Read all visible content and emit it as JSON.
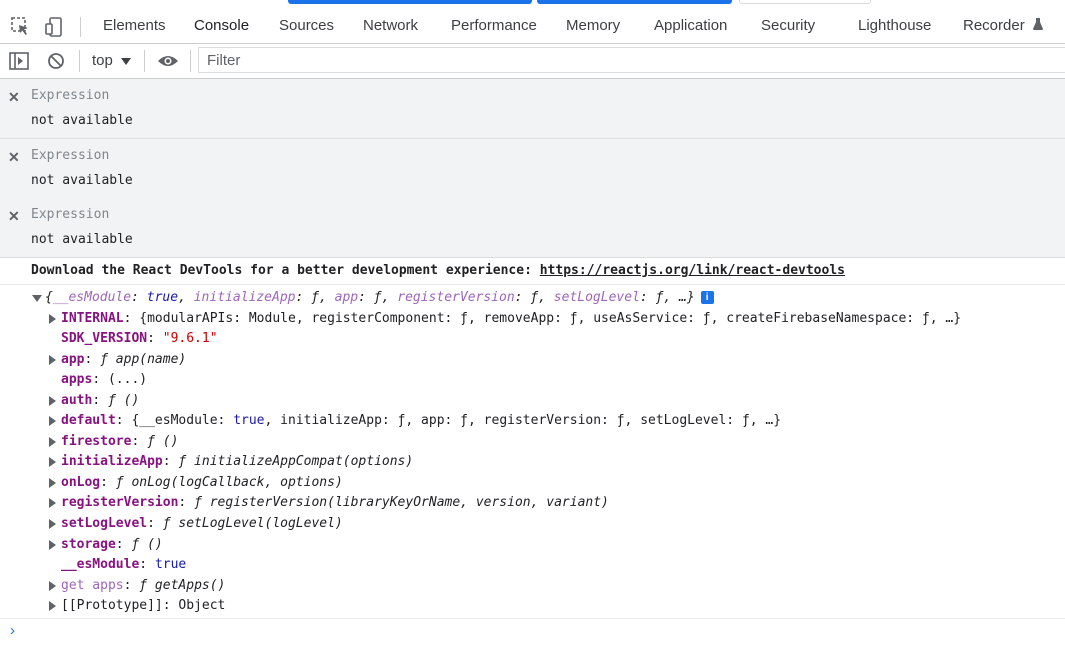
{
  "tabs": [
    "Elements",
    "Console",
    "Sources",
    "Network",
    "Performance",
    "Memory",
    "Application",
    "Security",
    "Lighthouse",
    "Recorder"
  ],
  "toolbar": {
    "context": "top",
    "filter_placeholder": "Filter"
  },
  "expressions": [
    {
      "title": "Expression",
      "value": "not available"
    },
    {
      "title": "Expression",
      "value": "not available"
    },
    {
      "title": "Expression",
      "value": "not available"
    }
  ],
  "download_msg": {
    "text": "Download the React DevTools for a better development experience: ",
    "link": "https://reactjs.org/link/react-devtools"
  },
  "object": {
    "summary": {
      "open": "{",
      "p1k": "__esModule",
      "p1v": "true",
      "p2k": "initializeApp",
      "p2v": "ƒ",
      "p3k": "app",
      "p3v": "ƒ",
      "p4k": "registerVersion",
      "p4v": "ƒ",
      "p5k": "setLogLevel",
      "p5v": "ƒ",
      "close": "…}",
      "info": "i"
    },
    "rows": {
      "internal_k": "INTERNAL",
      "internal_v": "{modularAPIs: Module, registerComponent: ƒ, removeApp: ƒ, useAsService: ƒ, createFirebaseNamespace: ƒ, …}",
      "sdk_k": "SDK_VERSION",
      "sdk_v": "\"9.6.1\"",
      "app_k": "app",
      "app_v": "ƒ app(name)",
      "apps_k": "apps",
      "apps_v": "(...)",
      "auth_k": "auth",
      "auth_v": "ƒ ()",
      "default_k": "default",
      "default_open": "{__esModule: ",
      "default_true": "true",
      "default_rest": ", initializeApp: ƒ, app: ƒ, registerVersion: ƒ, setLogLevel: ƒ, …}",
      "firestore_k": "firestore",
      "firestore_v": "ƒ ()",
      "init_k": "initializeApp",
      "init_v": "ƒ initializeAppCompat(options)",
      "onlog_k": "onLog",
      "onlog_v": "ƒ onLog(logCallback, options)",
      "regver_k": "registerVersion",
      "regver_v": "ƒ registerVersion(libraryKeyOrName, version, variant)",
      "setlog_k": "setLogLevel",
      "setlog_v": "ƒ setLogLevel(logLevel)",
      "storage_k": "storage",
      "storage_v": "ƒ ()",
      "esm_k": "__esModule",
      "esm_v": "true",
      "getapps_k": "get apps",
      "getapps_v": "ƒ getApps()",
      "proto_k": "[[Prototype]]",
      "proto_v": "Object"
    }
  },
  "prompt": "›"
}
